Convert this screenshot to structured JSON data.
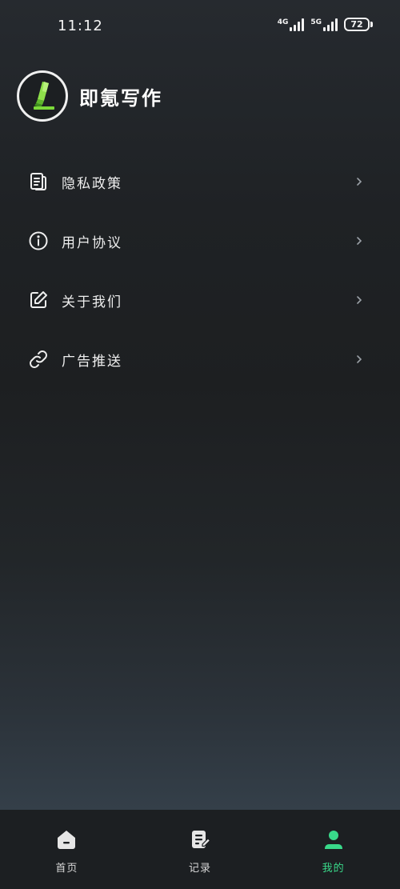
{
  "status_bar": {
    "time": "11:12",
    "network1": "4G",
    "network2": "5G",
    "battery": "72"
  },
  "app": {
    "name": "即氪写作",
    "logo_icon": "highlighter-icon"
  },
  "menu": {
    "items": [
      {
        "label": "隐私政策",
        "icon": "document-icon"
      },
      {
        "label": "用户协议",
        "icon": "info-icon"
      },
      {
        "label": "关于我们",
        "icon": "edit-icon"
      },
      {
        "label": "广告推送",
        "icon": "link-icon"
      }
    ]
  },
  "bottom_nav": {
    "tabs": [
      {
        "label": "首页",
        "icon": "home-icon"
      },
      {
        "label": "记录",
        "icon": "notes-icon"
      },
      {
        "label": "我的",
        "icon": "user-icon"
      }
    ],
    "active_index": 2
  },
  "colors": {
    "accent": "#39d98a",
    "logo_green": "#7bd93a",
    "nav_background": "#1c1f22"
  }
}
